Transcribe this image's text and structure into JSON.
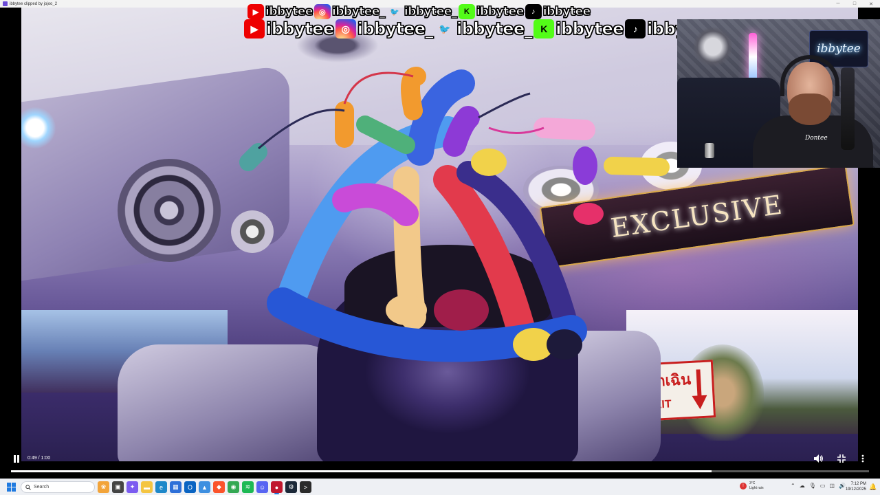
{
  "window": {
    "title": "ibbytee clipped by jojoo_2",
    "controls": [
      "─",
      "□",
      "✕"
    ]
  },
  "social_banner": {
    "handles": [
      {
        "platform": "youtube",
        "icon": "youtube-icon",
        "handle": "ibbytee",
        "glyph": "▶",
        "color": "#ee0000"
      },
      {
        "platform": "instagram",
        "icon": "instagram-icon",
        "handle": "ibbytee_",
        "glyph": "◎",
        "color": "#d6249f"
      },
      {
        "platform": "twitter",
        "icon": "twitter-icon",
        "handle": "ibbytee_",
        "glyph": "🐦",
        "color": "#1da1f2"
      },
      {
        "platform": "kick",
        "icon": "kick-icon",
        "handle": "ibbytee",
        "glyph": "K",
        "color": "#53fc18"
      },
      {
        "platform": "tiktok",
        "icon": "tiktok-icon",
        "handle": "ibbytee",
        "glyph": "♪",
        "color": "#000000"
      }
    ]
  },
  "scene": {
    "sign_text": "EXCLUSIVE",
    "exit_thai": "ฉุกเฉิน",
    "exit_text": "EXIT"
  },
  "webcam": {
    "neon_sign": "ibbytee",
    "shirt_text": "Dontee"
  },
  "player": {
    "time_display": "0:49 / 1:00",
    "progress": 0.8167,
    "pause_icon": "pause-icon",
    "volume_icon": "volume-icon",
    "exit_fullscreen_icon": "exit-fullscreen-icon",
    "more_icon": "more-vert-icon"
  },
  "taskbar": {
    "search_placeholder": "Search",
    "weather_temp": "3°C",
    "weather_desc": "Light rain",
    "time": "7:12 PM",
    "date": "19/12/2025",
    "apps": [
      {
        "name": "widgets-app",
        "color": "#f2a43a",
        "glyph": "❀"
      },
      {
        "name": "file-explorer-app",
        "color": "#444",
        "glyph": "▣"
      },
      {
        "name": "copilot-app",
        "color": "#7b5cf0",
        "glyph": "✦"
      },
      {
        "name": "folder-app",
        "color": "#f4c542",
        "glyph": "▬"
      },
      {
        "name": "edge-app",
        "color": "#1e88c9",
        "glyph": "e"
      },
      {
        "name": "store-app",
        "color": "#2d6fd8",
        "glyph": "▦"
      },
      {
        "name": "outlook-app",
        "color": "#0a64c2",
        "glyph": "O"
      },
      {
        "name": "photos-app",
        "color": "#3d8fe0",
        "glyph": "▲"
      },
      {
        "name": "brave-app",
        "color": "#fb542b",
        "glyph": "◆"
      },
      {
        "name": "chrome-app",
        "color": "#34a853",
        "glyph": "◉"
      },
      {
        "name": "spotify-app",
        "color": "#1db954",
        "glyph": "≋"
      },
      {
        "name": "discord-app",
        "color": "#5865f2",
        "glyph": "☺"
      },
      {
        "name": "streamlabs-app",
        "color": "#c0172e",
        "glyph": "●",
        "active": true
      },
      {
        "name": "steam-app",
        "color": "#1b2838",
        "glyph": "⚙"
      },
      {
        "name": "terminal-app",
        "color": "#2b2b2b",
        "glyph": ">"
      }
    ]
  }
}
